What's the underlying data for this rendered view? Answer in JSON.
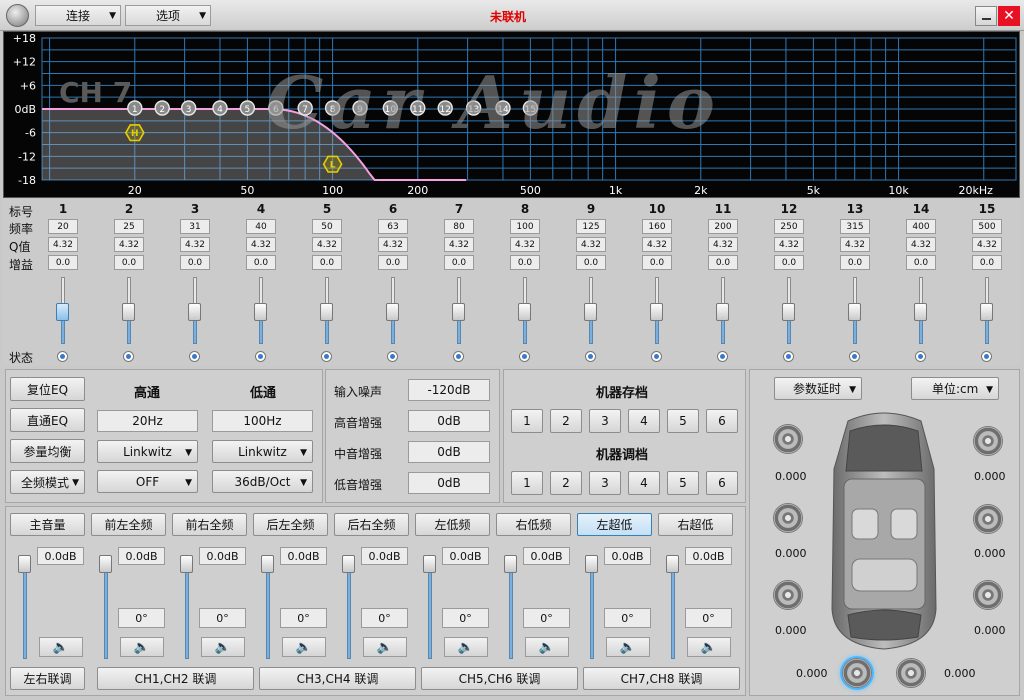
{
  "titlebar": {
    "menu_connect": "连接",
    "menu_options": "选项",
    "status": "未联机",
    "status_color": "#e00000"
  },
  "eq": {
    "y_labels": [
      "+18",
      "+12",
      "+6",
      "0dB",
      "-6",
      "-12",
      "-18"
    ],
    "x_labels": [
      "20",
      "50",
      "100",
      "200",
      "500",
      "1k",
      "2k",
      "5k",
      "10k",
      "20kHz"
    ],
    "channel_label": "CH 7",
    "watermark": "Car Audio",
    "hp_marker": "H",
    "lp_marker": "L",
    "points": [
      "1",
      "2",
      "3",
      "4",
      "5",
      "6",
      "7",
      "8",
      "9",
      "10",
      "11",
      "12",
      "13",
      "14",
      "15"
    ]
  },
  "bands": {
    "row_labels": {
      "id": "标号",
      "freq": "频率",
      "q": "Q值",
      "gain": "增益",
      "state": "状态"
    },
    "items": [
      {
        "id": "1",
        "freq": "20",
        "q": "4.32",
        "gain": "0.0"
      },
      {
        "id": "2",
        "freq": "25",
        "q": "4.32",
        "gain": "0.0"
      },
      {
        "id": "3",
        "freq": "31",
        "q": "4.32",
        "gain": "0.0"
      },
      {
        "id": "4",
        "freq": "40",
        "q": "4.32",
        "gain": "0.0"
      },
      {
        "id": "5",
        "freq": "50",
        "q": "4.32",
        "gain": "0.0"
      },
      {
        "id": "6",
        "freq": "63",
        "q": "4.32",
        "gain": "0.0"
      },
      {
        "id": "7",
        "freq": "80",
        "q": "4.32",
        "gain": "0.0"
      },
      {
        "id": "8",
        "freq": "100",
        "q": "4.32",
        "gain": "0.0"
      },
      {
        "id": "9",
        "freq": "125",
        "q": "4.32",
        "gain": "0.0"
      },
      {
        "id": "10",
        "freq": "160",
        "q": "4.32",
        "gain": "0.0"
      },
      {
        "id": "11",
        "freq": "200",
        "q": "4.32",
        "gain": "0.0"
      },
      {
        "id": "12",
        "freq": "250",
        "q": "4.32",
        "gain": "0.0"
      },
      {
        "id": "13",
        "freq": "315",
        "q": "4.32",
        "gain": "0.0"
      },
      {
        "id": "14",
        "freq": "400",
        "q": "4.32",
        "gain": "0.0"
      },
      {
        "id": "15",
        "freq": "500",
        "q": "4.32",
        "gain": "0.0"
      }
    ]
  },
  "filters": {
    "reset_eq": "复位EQ",
    "bypass_eq": "直通EQ",
    "param_eq": "参量均衡",
    "full_mode": "全频模式",
    "hp_title": "高通",
    "lp_title": "低通",
    "hp_freq": "20Hz",
    "lp_freq": "100Hz",
    "hp_type": "Linkwitz",
    "lp_type": "Linkwitz",
    "hp_slope": "OFF",
    "lp_slope": "36dB/Oct"
  },
  "gains": {
    "noise_label": "输入噪声",
    "noise_value": "-120dB",
    "treble_label": "高音增强",
    "treble_value": "0dB",
    "mid_label": "中音增强",
    "mid_value": "0dB",
    "bass_label": "低音增强",
    "bass_value": "0dB"
  },
  "presets": {
    "save_title": "机器存档",
    "load_title": "机器调档",
    "save": [
      "1",
      "2",
      "3",
      "4",
      "5",
      "6"
    ],
    "load": [
      "1",
      "2",
      "3",
      "4",
      "5",
      "6"
    ]
  },
  "mixer": {
    "channels": [
      {
        "label": "主音量",
        "db": "0.0dB"
      },
      {
        "label": "前左全频",
        "db": "0.0dB",
        "phase": "0°"
      },
      {
        "label": "前右全频",
        "db": "0.0dB",
        "phase": "0°"
      },
      {
        "label": "后左全频",
        "db": "0.0dB",
        "phase": "0°"
      },
      {
        "label": "后右全频",
        "db": "0.0dB",
        "phase": "0°"
      },
      {
        "label": "左低频",
        "db": "0.0dB",
        "phase": "0°"
      },
      {
        "label": "右低频",
        "db": "0.0dB",
        "phase": "0°"
      },
      {
        "label": "左超低",
        "db": "0.0dB",
        "phase": "0°"
      },
      {
        "label": "右超低",
        "db": "0.0dB",
        "phase": "0°"
      }
    ],
    "link_lr": "左右联调",
    "links": [
      "CH1,CH2 联调",
      "CH3,CH4 联调",
      "CH5,CH6 联调",
      "CH7,CH8 联调"
    ]
  },
  "delay": {
    "mode": "参数延时",
    "unit": "单位:cm",
    "values": {
      "fl": "0.000",
      "fr": "0.000",
      "ml": "0.000",
      "mr": "0.000",
      "rl": "0.000",
      "rr": "0.000",
      "sub_l": "0.000",
      "sub_r": "0.000"
    }
  }
}
